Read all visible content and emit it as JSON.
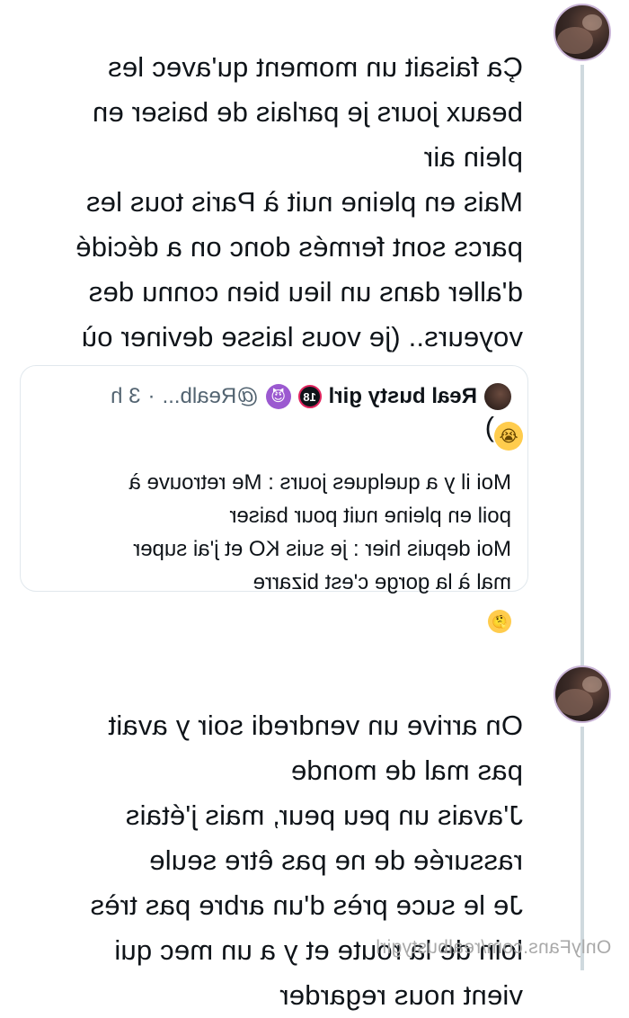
{
  "tweet1": {
    "text": "Ça faisait un moment qu'avec les\nbeaux jours je parlais de baiser en\nplein air\nMais en pleine nuit à Paris tous les\nparcs sont fermés donc on a décidé\nd'aller dans un lieu bien connu des\nvoyeurs.. (je vous laisse deviner où",
    "last_line_suffix": ")",
    "emoji": "loudly-crying-face"
  },
  "quote": {
    "name": "Real busty girl",
    "badge": "18",
    "devil_emoji": "smiling-face-with-horns",
    "handle": "@Realb...",
    "dot": "·",
    "time": "3 h",
    "body": "Moi il y a quelques jours : Me retrouve à\npoil en pleine nuit pour baiser\nMoi depuis hier : je suis KO et j'ai super\nmal à la gorge c'est bizarre",
    "emoji": "thinking-face"
  },
  "tweet2": {
    "text": "On arrive un vendredi soir y avait\npas mal de monde\nJ'avais un peu peur, mais j'étais\nrassurée de ne pas être seule\nJe le suce près d'un arbre pas très\nloin de la route et y a un mec qui\nvient nous regarder"
  },
  "watermark": "OnlyFans.com/realbustygirl",
  "colors": {
    "thread_line": "#cfd9de",
    "avatar_ring": "#c9b4d6",
    "muted_text": "#536471",
    "card_border": "#e1e8ed"
  }
}
